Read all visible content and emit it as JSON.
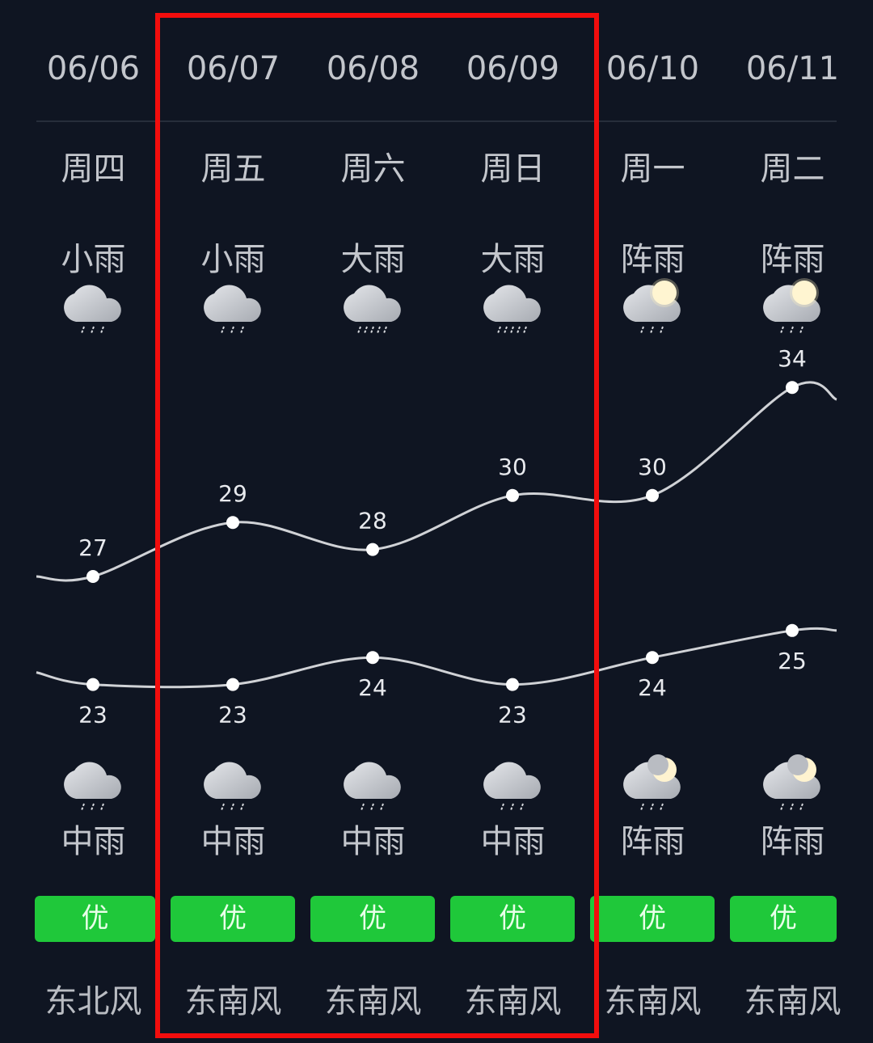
{
  "days": [
    {
      "date": "06/06",
      "weekday": "周四",
      "day_weather": "小雨",
      "day_icon": "cloud-rain-icon",
      "night_weather": "中雨",
      "night_icon": "cloud-rain-icon",
      "high": 27,
      "low": 23,
      "aqi": "优",
      "wind": "东北风"
    },
    {
      "date": "06/07",
      "weekday": "周五",
      "day_weather": "小雨",
      "day_icon": "cloud-rain-icon",
      "night_weather": "中雨",
      "night_icon": "cloud-rain-icon",
      "high": 29,
      "low": 23,
      "aqi": "优",
      "wind": "东南风"
    },
    {
      "date": "06/08",
      "weekday": "周六",
      "day_weather": "大雨",
      "day_icon": "cloud-heavy-rain-icon",
      "night_weather": "中雨",
      "night_icon": "cloud-rain-icon",
      "high": 28,
      "low": 24,
      "aqi": "优",
      "wind": "东南风"
    },
    {
      "date": "06/09",
      "weekday": "周日",
      "day_weather": "大雨",
      "day_icon": "cloud-heavy-rain-icon",
      "night_weather": "中雨",
      "night_icon": "cloud-rain-icon",
      "high": 30,
      "low": 23,
      "aqi": "优",
      "wind": "东南风"
    },
    {
      "date": "06/10",
      "weekday": "周一",
      "day_weather": "阵雨",
      "day_icon": "sun-cloud-rain-icon",
      "night_weather": "阵雨",
      "night_icon": "moon-cloud-rain-icon",
      "high": 30,
      "low": 24,
      "aqi": "优",
      "wind": "东南风"
    },
    {
      "date": "06/11",
      "weekday": "周二",
      "day_weather": "阵雨",
      "day_icon": "sun-cloud-rain-icon",
      "night_weather": "阵雨",
      "night_icon": "moon-cloud-rain-icon",
      "high": 34,
      "low": 25,
      "aqi": "优",
      "wind": "东南风"
    }
  ],
  "colors": {
    "background": "#0f1522",
    "aqi_good": "#1fc83a",
    "highlight_frame": "#f20d0d",
    "curve": "#d0d2d6"
  },
  "highlight": {
    "from_date": "06/07",
    "to_date": "06/09"
  }
}
